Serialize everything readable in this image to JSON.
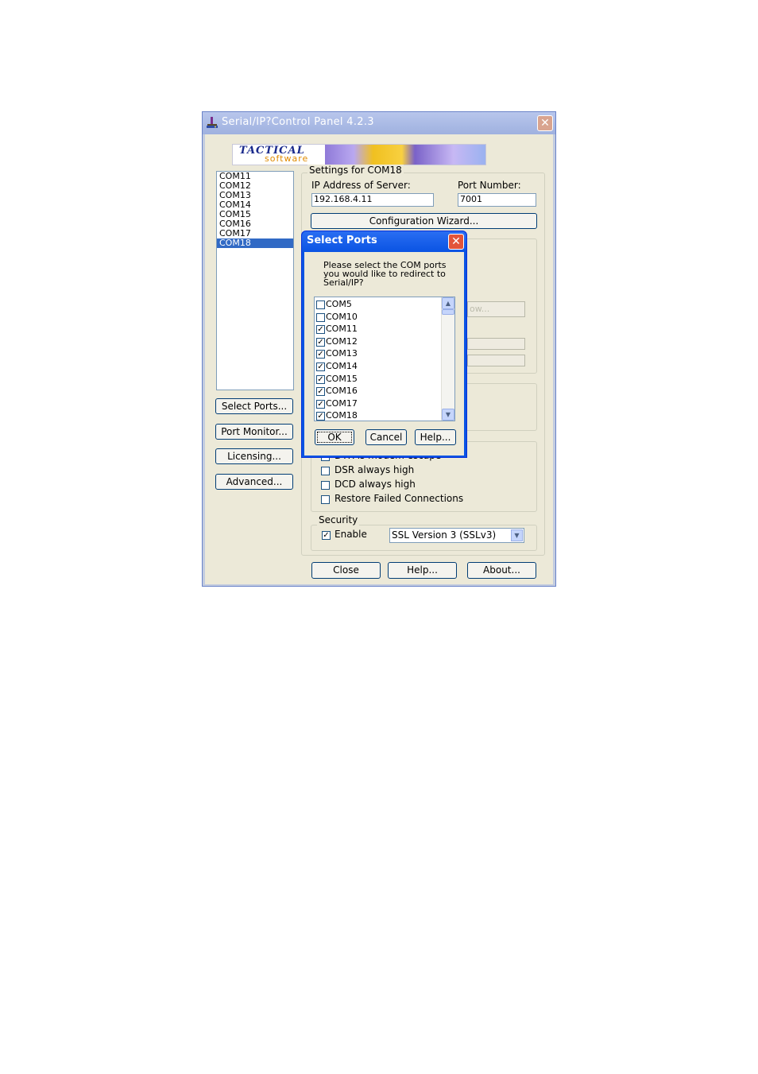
{
  "window": {
    "title": "Serial/IP?Control Panel 4.2.3",
    "close_label": "✕"
  },
  "logo": {
    "line1": "TACTICAL",
    "line2": "software"
  },
  "port_list": {
    "items": [
      "COM11",
      "COM12",
      "COM13",
      "COM14",
      "COM15",
      "COM16",
      "COM17",
      "COM18"
    ],
    "selected": "COM18"
  },
  "left_buttons": {
    "select_ports": "Select Ports...",
    "port_monitor": "Port Monitor...",
    "licensing": "Licensing...",
    "advanced": "Advanced..."
  },
  "settings": {
    "group_label": "Settings for COM18",
    "ip_label": "IP Address of Server:",
    "ip_value": "192.168.4.11",
    "port_label": "Port Number:",
    "port_value": "7001",
    "config_wizard": "Configuration Wizard...",
    "partial_button_text": "ow...",
    "options": [
      {
        "label": "DTR is modem escape",
        "checked": false
      },
      {
        "label": "DSR always high",
        "checked": false
      },
      {
        "label": "DCD always high",
        "checked": false
      },
      {
        "label": "Restore Failed Connections",
        "checked": false
      }
    ],
    "security_label": "Security",
    "enable_label": "Enable",
    "enable_checked": true,
    "ssl_value": "SSL Version 3 (SSLv3)"
  },
  "bottom_buttons": {
    "close": "Close",
    "help": "Help...",
    "about": "About..."
  },
  "dialog": {
    "title": "Select Ports",
    "prompt": "Please select the COM ports you would like to redirect to Serial/IP?",
    "ports": [
      {
        "label": "COM5",
        "checked": false
      },
      {
        "label": "COM10",
        "checked": false
      },
      {
        "label": "COM11",
        "checked": true
      },
      {
        "label": "COM12",
        "checked": true
      },
      {
        "label": "COM13",
        "checked": true
      },
      {
        "label": "COM14",
        "checked": true
      },
      {
        "label": "COM15",
        "checked": true
      },
      {
        "label": "COM16",
        "checked": true
      },
      {
        "label": "COM17",
        "checked": true
      },
      {
        "label": "COM18",
        "checked": true
      }
    ],
    "ok": "OK",
    "cancel": "Cancel",
    "help": "Help..."
  },
  "colors": {
    "title_bar_inactive": "#9fb1df",
    "dialog_title": "#0a54e3",
    "selection": "#316ac5",
    "client_bg": "#ece9d8"
  }
}
